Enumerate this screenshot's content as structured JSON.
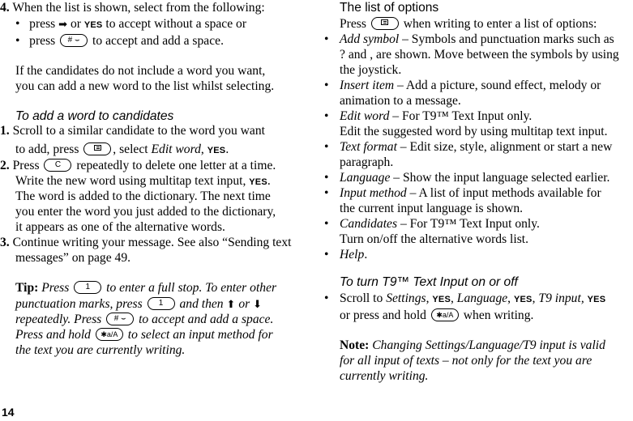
{
  "page_number": "14",
  "left": {
    "step4": {
      "num": "4.",
      "text": "When the list is shown, select from the following:",
      "bullets": [
        {
          "pre": "press",
          "arrow": "➡",
          "mid": "or",
          "yes": "YES",
          "post": "to accept without a space or"
        },
        {
          "pre": "press",
          "key": "# ⌣",
          "post": "to accept and add a space."
        }
      ],
      "para": [
        "If the candidates do not include a word you want,",
        "you can add a new word to the list whilst selecting."
      ]
    },
    "add_word": {
      "heading": "To add a word to candidates",
      "steps": [
        {
          "num": "1.",
          "line1": "Scroll to a similar candidate to the word you want",
          "line2_pre": "to add, press",
          "line2_mid": ", select",
          "line2_it": "Edit word",
          "line2_sep": ",",
          "yes": "YES",
          "line2_end": "."
        },
        {
          "num": "2.",
          "line1_pre": "Press",
          "key": "C",
          "line1_post": "repeatedly to delete one letter at a time.",
          "line2": "Write the new word using multitap text input,",
          "yes": "YES",
          "line2_end": ".",
          "line3": "The word is added to the dictionary. The next time",
          "line4": "you enter the word you just added to the dictionary,",
          "line5": "it appears as one of the alternative words."
        },
        {
          "num": "3.",
          "line1": "Continue writing your message. See also “Sending text",
          "line2": "messages” on page 49."
        }
      ]
    },
    "tip": {
      "label": "Tip:",
      "l1_a": "Press",
      "key1": "1",
      "l1_b": "to enter a full stop. To enter other",
      "l2_a": "punctuation marks, press",
      "key2": "1",
      "l2_b": "and then",
      "up": "⬆",
      "l2_or": "or",
      "down": "⬇",
      "l3_a": "repeatedly. Press",
      "key3": "# ⌣",
      "l3_b": "to accept and add a space.",
      "l4_a": "Press and hold",
      "key4": "✱a/A",
      "l4_b": "to select an input method for",
      "l5": "the text you are currently writing."
    }
  },
  "right": {
    "heading": "The list of options",
    "intro_pre": "Press",
    "intro_post": "when writing to enter a list of options:",
    "options": [
      {
        "term": "Add symbol",
        "dash": " – ",
        "lines": [
          "Symbols and punctuation marks such as",
          "? and , are shown. Move between the symbols by using",
          "the joystick."
        ]
      },
      {
        "term": "Insert item",
        "dash": " – ",
        "lines": [
          "Add a picture, sound effect, melody or",
          "animation to a message."
        ]
      },
      {
        "term": "Edit word",
        "dash": " – ",
        "lines": [
          "For T9™ Text Input only.",
          "Edit the suggested word by using multitap text input."
        ]
      },
      {
        "term": "Text format",
        "dash": " – ",
        "lines": [
          "Edit size, style, alignment or start a new",
          "paragraph."
        ]
      },
      {
        "term": "Language",
        "dash": " – ",
        "lines": [
          "Show the input language selected earlier."
        ]
      },
      {
        "term": "Input method",
        "dash": " – ",
        "lines": [
          "A list of input methods available for",
          "the current input language is shown."
        ]
      },
      {
        "term": "Candidates",
        "dash": " – ",
        "lines": [
          "For T9™ Text Input only.",
          "Turn on/off the alternative words list."
        ]
      },
      {
        "term": "Help",
        "dash": "",
        "lines": [
          "."
        ]
      }
    ],
    "t9": {
      "heading": "To turn T9™ Text Input on or off",
      "l1_a": "Scroll to",
      "settings": "Settings",
      "yes1": "YES",
      "language": "Language",
      "yes2": "YES",
      "t9input": "T9 input,",
      "yes3": "YES",
      "l2_a": "or press and hold",
      "key": "✱a/A",
      "l2_b": "when writing."
    },
    "note": {
      "label": "Note:",
      "l1": "Changing Settings/Language/T9 input is valid",
      "l2": "for all input of texts – not only for the text you are",
      "l3": "currently writing."
    }
  }
}
